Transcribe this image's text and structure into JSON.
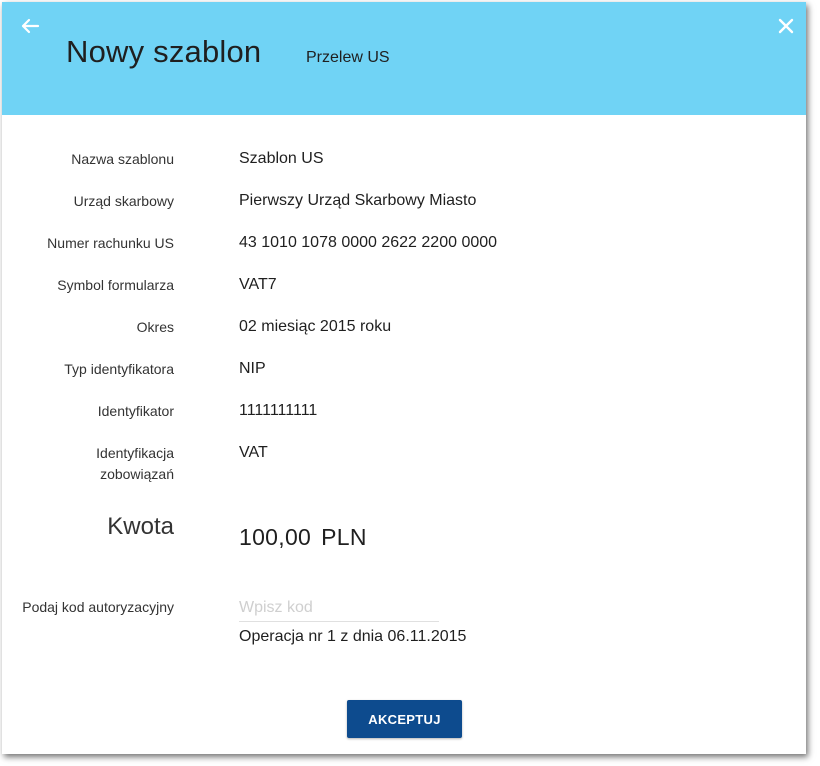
{
  "header": {
    "title": "Nowy szablon",
    "subtitle": "Przelew US",
    "back_icon": "arrow-left-icon",
    "close_icon": "close-icon",
    "background_color": "#70d3f5"
  },
  "fields": [
    {
      "label": "Nazwa szablonu",
      "value": "Szablon US"
    },
    {
      "label": "Urząd skarbowy",
      "value": "Pierwszy Urząd Skarbowy Miasto"
    },
    {
      "label": "Numer rachunku US",
      "value": "43 1010 1078 0000 2622 2200 0000"
    },
    {
      "label": "Symbol formularza",
      "value": "VAT7"
    },
    {
      "label": "Okres",
      "value": "02 miesiąc 2015 roku"
    },
    {
      "label": "Typ identyfikatora",
      "value": "NIP"
    },
    {
      "label": "Identyfikator",
      "value": "1111111111"
    },
    {
      "label_line1": "Identyfikacja",
      "label_line2": "zobowiązań",
      "value": "VAT"
    }
  ],
  "amount": {
    "label": "Kwota",
    "value": "100,00",
    "currency": "PLN"
  },
  "authorization": {
    "label": "Podaj kod autoryzacyjny",
    "placeholder": "Wpisz kod",
    "value": "",
    "operation_text": "Operacja nr 1 z dnia 06.11.2015"
  },
  "actions": {
    "accept_label": "AKCEPTUJ",
    "accept_color": "#0d4b8e"
  }
}
